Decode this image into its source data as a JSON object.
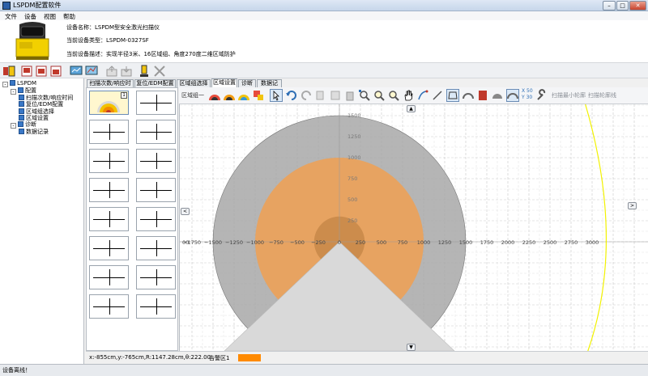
{
  "window": {
    "title": "LSPDM配置软件",
    "minimize": "–",
    "maximize": "□",
    "close": "✕"
  },
  "menu": [
    "文件",
    "设备",
    "视图",
    "帮助"
  ],
  "device": {
    "name_line": "设备名称：LSPDM型安全激光扫描仪",
    "type_line": "当前设备类型：LSPDM-0327SF",
    "desc_line": "当前设备描述：实现半径3米、16区域组、角度270度二维区域防护"
  },
  "tree": [
    {
      "label": "LSPDM",
      "level": 0,
      "expand": "-"
    },
    {
      "label": "配置",
      "level": 1,
      "expand": "-"
    },
    {
      "label": "扫描次数/响应时间",
      "level": 2
    },
    {
      "label": "复位/EDM配置",
      "level": 2
    },
    {
      "label": "区域组选择",
      "level": 2
    },
    {
      "label": "区域设置",
      "level": 2
    },
    {
      "label": "诊断",
      "level": 1,
      "expand": "-"
    },
    {
      "label": "数据记录",
      "level": 2
    }
  ],
  "tabs": [
    "扫描次数/响应时间",
    "复位/EDM配置",
    "区域组选择",
    "区域设置",
    "诊断",
    "数据记录"
  ],
  "active_tab": 3,
  "zone_toolbar": {
    "group_label": "区域组一",
    "coord_label_x": "X 50",
    "coord_label_y": "Y 30",
    "min_contour": "扫描最小轮廓",
    "contour_line": "扫描轮廓线"
  },
  "thumb_badge": "1",
  "plot": {
    "x_ticks": [
      -1750,
      -1500,
      -1250,
      -1000,
      -750,
      -500,
      -250,
      0,
      250,
      500,
      750,
      1000,
      1250,
      1500,
      1750,
      2000,
      2250,
      2500,
      2750,
      3000
    ],
    "y_ticks": [
      1500,
      1250,
      1000,
      750,
      500,
      250
    ],
    "x_axis_edge_label": "00",
    "colors": {
      "outer_zone": "#a8a8a8",
      "warning_zone": "#eba25a",
      "inner_zone": "#c98a4a",
      "blind_area": "#d9d9d9",
      "contour": "#f2f200"
    }
  },
  "status": {
    "coords": "x:-855cm,y:-765cm,R:1147.28cm,θ:222.00",
    "warning_label": "告警区1",
    "warning_color": "#ff8a00",
    "device_status": "设备离线！"
  },
  "nav": {
    "up": "▲",
    "down": "▼",
    "left": "<",
    "right": ">"
  }
}
